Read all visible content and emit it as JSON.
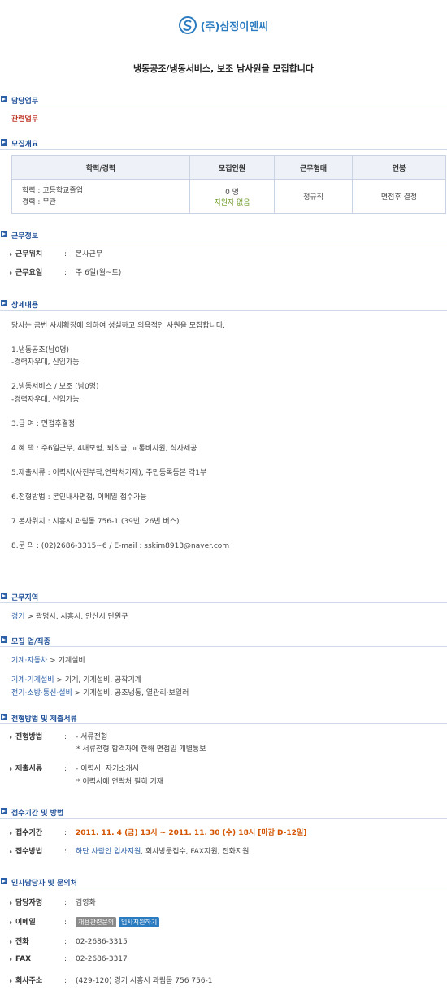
{
  "company": {
    "name": "(주)삼정이엔씨"
  },
  "page_title": "냉동공조/냉동서비스, 보조 남사원을 모집합니다",
  "duty": {
    "heading": "담당업무",
    "value": "관련업무"
  },
  "overview": {
    "heading": "모집개요",
    "columns": [
      "학력/경력",
      "모집인원",
      "근무형태",
      "연봉"
    ],
    "edu": "학력 : 고등학교졸업",
    "career": "경력 : 무관",
    "headcount": "0 명",
    "applicants": "지원자 없음",
    "type": "정규직",
    "salary": "면접후 결정"
  },
  "work_info": {
    "heading": "근무정보",
    "rows": [
      {
        "key": "근무위치",
        "value": "본사근무"
      },
      {
        "key": "근무요일",
        "value": "주 6일(월~토)"
      }
    ]
  },
  "details": {
    "heading": "상세내용",
    "intro": "당사는 금번 사세확장에 의하여 성실하고 의욕적인 사원을 모집합니다.",
    "lines": [
      "1.냉동공조(남0명)",
      "-경력자우대, 신입가능",
      "2.냉동서비스 / 보조 (남0명)",
      "-경력자우대, 신입가능",
      "3.급 여 : 면접후결정",
      "4.혜 택 : 주6일근무, 4대보험, 퇴직금, 교통비지원, 식사제공",
      "5.제출서류 : 이력서(사진부착,연락처기재), 주민등록등본 각1부",
      "6.전형방법 : 본인내사면접, 이메일 접수가능",
      "7.본사위치 : 시흥시 과림동 756-1 (39번, 26번 버스)",
      "8.문 의 : (02)2686-3315~6 / E-mail : sskim8913@naver.com"
    ]
  },
  "region": {
    "heading": "근무지역",
    "prefix": "경기",
    "sep": ">",
    "value": "광명시, 시흥시, 안산시 단원구"
  },
  "jobs": {
    "heading": "모집 업/직종",
    "industry_cat": "기계·자동차",
    "industry_val": "기계설비",
    "job1_cat": "기계·기계설비",
    "job1_val": "기계, 기계설비, 공작기계",
    "job2_cat": "전기·소방·통신·설비",
    "job2_val": "기계설비, 공조냉동, 열관리·보일러",
    "sep": ">"
  },
  "screening": {
    "heading": "전형방법 및 제출서류",
    "method_key": "전형방법",
    "method_1": "- 서류전형",
    "method_2": "* 서류전형 합격자에 한해 면접일 개별통보",
    "docs_key": "제출서류",
    "docs_1": "- 이력서, 자기소개서",
    "docs_2": "* 이력서에 연락처 필히 기재"
  },
  "application": {
    "heading": "접수기간 및 방법",
    "period_key": "접수기간",
    "period_value": "2011. 11. 4 (금) 13시 ~ 2011. 11. 30 (수) 18시 [마감 D-12일]",
    "method_key": "접수방법",
    "method_link": "하단 사람인 입사지원",
    "method_rest": ", 회사방문접수, FAX지원, 전화지원"
  },
  "contact": {
    "heading": "인사담당자 및 문의처",
    "name_key": "담당자명",
    "name": "김영화",
    "email_key": "이메일",
    "email_btn1": "채용관련문의",
    "email_btn2": "입사지원하기",
    "phone_key": "전화",
    "phone": "02-2686-3315",
    "fax_key": "FAX",
    "fax": "02-2686-3317",
    "addr_key": "회사주소",
    "addr": "(429-120) 경기 시흥시 과림동 756 756-1"
  },
  "colors": {
    "accent": "#1e4f98",
    "link": "#2b5fa8",
    "highlight": "#d35400"
  }
}
